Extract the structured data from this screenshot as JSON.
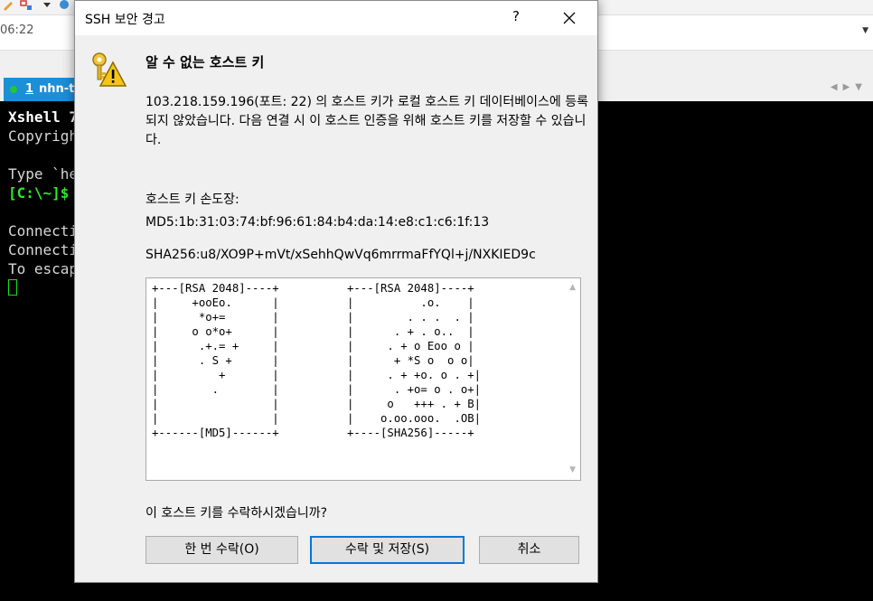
{
  "background_app": {
    "address_text": "06:22",
    "tab": {
      "number": "1",
      "name": "nhn-to"
    },
    "terminal_lines": [
      {
        "text": "Xshell 7",
        "color": "#ffffff",
        "bold": true
      },
      {
        "text": "Copyrigh",
        "color": "#d8d8d8",
        "bold": false
      },
      {
        "text": "",
        "color": "#d8d8d8",
        "bold": false
      },
      {
        "text": "Type `he",
        "color": "#d8d8d8",
        "bold": false
      },
      {
        "text": "[C:\\~]$",
        "color": "#2ee82e",
        "bold": true
      },
      {
        "text": "",
        "color": "#d8d8d8",
        "bold": false
      },
      {
        "text": "Connecti",
        "color": "#d8d8d8",
        "bold": false
      },
      {
        "text": "Connecti",
        "color": "#d8d8d8",
        "bold": false
      },
      {
        "text": "To escap",
        "color": "#d8d8d8",
        "bold": false
      }
    ]
  },
  "dialog": {
    "title": "SSH 보안 경고",
    "help_label": "?",
    "heading": "알 수 없는 호스트 키",
    "message": "103.218.159.196(포트: 22) 의 호스트 키가 로컬 호스트 키 데이터베이스에 등록되지 않았습니다. 다음 연결 시 이 호스트 인증을 위해 호스트 키를 저장할 수 있습니다.",
    "fingerprint_label": "호스트 키 손도장:",
    "md5": "MD5:1b:31:03:74:bf:96:61:84:b4:da:14:e8:c1:c6:1f:13",
    "sha256": "SHA256:u8/XO9P+mVt/xSehhQwVq6mrrmaFfYQl+j/NXKIED9c",
    "randomart_md5": "+---[RSA 2048]----+\n|     +ooEo.      |\n|      *o+=       |\n|     o o*o+      |\n|      .+.= +     |\n|      . S +      |\n|         +       |\n|        .        |\n|                 |\n|                 |\n+------[MD5]------+",
    "randomart_sha256": "+---[RSA 2048]----+\n|          .o.    |\n|        . . .  . |\n|      . + . o..  |\n|     . + o Eoo o |\n|      + *S o  o o|\n|     . + +o. o . +|\n|      . +o= o . o+|\n|     o   +++ . + B|\n|    o.oo.ooo.  .OB|\n+----[SHA256]-----+",
    "question": "이 호스트 키를 수락하시겠습니까?",
    "buttons": {
      "accept_once": "한 번 수락(O)",
      "accept_save": "수락 및 저장(S)",
      "cancel": "취소"
    }
  },
  "colors": {
    "tab_active": "#1b8fd8",
    "focus_border": "#0078d7",
    "prompt_green": "#2ee82e"
  },
  "icons": [
    "warning-key-icon",
    "close-icon",
    "help-icon",
    "scroll-up-icon",
    "scroll-down-icon"
  ]
}
